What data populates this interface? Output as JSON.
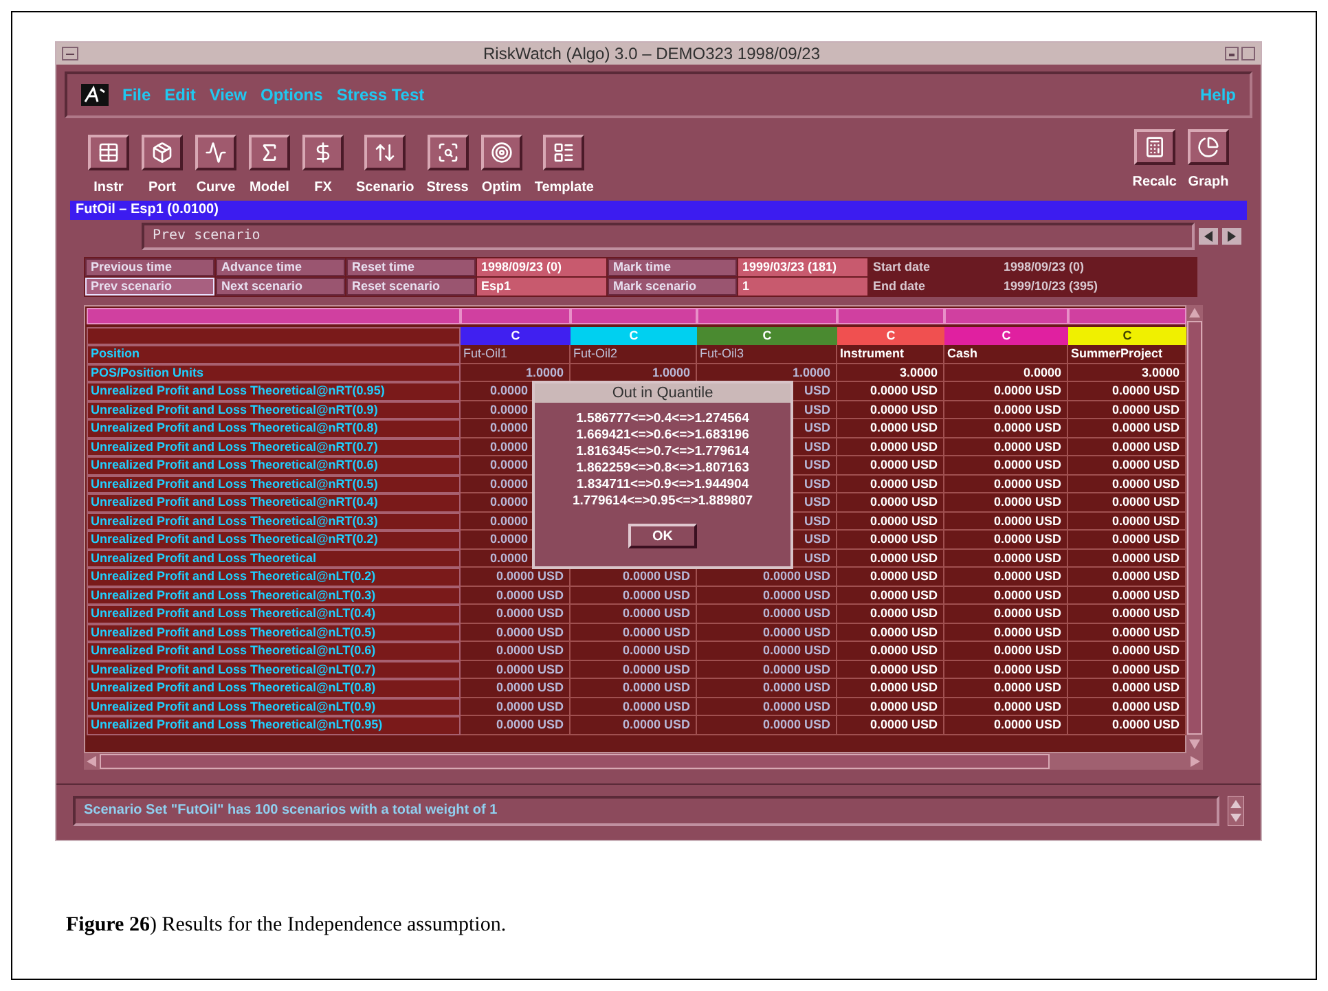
{
  "window": {
    "title": "RiskWatch (Algo) 3.0 – DEMO323 1998/09/23"
  },
  "menu": [
    "File",
    "Edit",
    "View",
    "Options",
    "Stress Test"
  ],
  "help_menu": "Help",
  "toolbar": [
    "Instr",
    "Port",
    "Curve",
    "Model",
    "FX",
    "Scenario",
    "Stress",
    "Optim",
    "Template"
  ],
  "toolbar_right": [
    "Recalc",
    "Graph"
  ],
  "panel": {
    "title": "FutOil – Esp1 (0.0100)",
    "scenario_field": "Prev scenario"
  },
  "controls": [
    [
      {
        "kind": "button",
        "text": "Previous time",
        "selected": false
      },
      {
        "kind": "button",
        "text": "Advance time",
        "selected": false
      },
      {
        "kind": "button",
        "text": "Reset time",
        "selected": false
      },
      {
        "kind": "value",
        "text": "1998/09/23 (0)"
      },
      {
        "kind": "button",
        "text": "Mark time",
        "selected": false
      },
      {
        "kind": "value",
        "text": "1999/03/23 (181)"
      },
      {
        "kind": "label",
        "text": "Start date"
      },
      {
        "kind": "label",
        "text": "1998/09/23 (0)"
      }
    ],
    [
      {
        "kind": "button",
        "text": "Prev scenario",
        "selected": true
      },
      {
        "kind": "button",
        "text": "Next scenario",
        "selected": false
      },
      {
        "kind": "button",
        "text": "Reset scenario",
        "selected": false
      },
      {
        "kind": "value",
        "text": "Esp1"
      },
      {
        "kind": "button",
        "text": "Mark scenario",
        "selected": false
      },
      {
        "kind": "value",
        "text": "1"
      },
      {
        "kind": "label",
        "text": "End date"
      },
      {
        "kind": "label",
        "text": "1999/10/23 (395)"
      }
    ]
  ],
  "table": {
    "columns": [
      {
        "code": "C",
        "color": "#4020f0",
        "name": "Fut-Oil1"
      },
      {
        "code": "C",
        "color": "#00d0f0",
        "name": "Fut-Oil2"
      },
      {
        "code": "C",
        "color": "#4a8a30",
        "name": "Fut-Oil3"
      },
      {
        "code": "C",
        "color": "#f05050",
        "name": "Instrument"
      },
      {
        "code": "C",
        "color": "#e020a0",
        "name": "Cash"
      },
      {
        "code": "C",
        "color": "#f0f000",
        "name": "SummerProject"
      }
    ],
    "position_label": "Position",
    "rows": [
      {
        "label": "POS/Position Units",
        "covered": false,
        "values": [
          "1.0000",
          "1.0000",
          "1.0000",
          "3.0000",
          "0.0000",
          "3.0000"
        ]
      },
      {
        "label": "Unrealized Profit and Loss Theoretical@nRT(0.95)",
        "covered": true,
        "values": [
          "0.0000",
          "USD",
          "0.0000 USD",
          "0.0000 USD",
          "0.0000 USD"
        ]
      },
      {
        "label": "Unrealized Profit and Loss Theoretical@nRT(0.9)",
        "covered": true,
        "values": [
          "0.0000",
          "USD",
          "0.0000 USD",
          "0.0000 USD",
          "0.0000 USD"
        ]
      },
      {
        "label": "Unrealized Profit and Loss Theoretical@nRT(0.8)",
        "covered": true,
        "values": [
          "0.0000",
          "USD",
          "0.0000 USD",
          "0.0000 USD",
          "0.0000 USD"
        ]
      },
      {
        "label": "Unrealized Profit and Loss Theoretical@nRT(0.7)",
        "covered": true,
        "values": [
          "0.0000",
          "USD",
          "0.0000 USD",
          "0.0000 USD",
          "0.0000 USD"
        ]
      },
      {
        "label": "Unrealized Profit and Loss Theoretical@nRT(0.6)",
        "covered": true,
        "values": [
          "0.0000",
          "USD",
          "0.0000 USD",
          "0.0000 USD",
          "0.0000 USD"
        ]
      },
      {
        "label": "Unrealized Profit and Loss Theoretical@nRT(0.5)",
        "covered": true,
        "values": [
          "0.0000",
          "USD",
          "0.0000 USD",
          "0.0000 USD",
          "0.0000 USD"
        ]
      },
      {
        "label": "Unrealized Profit and Loss Theoretical@nRT(0.4)",
        "covered": true,
        "values": [
          "0.0000",
          "USD",
          "0.0000 USD",
          "0.0000 USD",
          "0.0000 USD"
        ]
      },
      {
        "label": "Unrealized Profit and Loss Theoretical@nRT(0.3)",
        "covered": true,
        "values": [
          "0.0000",
          "USD",
          "0.0000 USD",
          "0.0000 USD",
          "0.0000 USD"
        ]
      },
      {
        "label": "Unrealized Profit and Loss Theoretical@nRT(0.2)",
        "covered": true,
        "values": [
          "0.0000",
          "USD",
          "0.0000 USD",
          "0.0000 USD",
          "0.0000 USD"
        ]
      },
      {
        "label": "Unrealized Profit and Loss Theoretical",
        "covered": true,
        "values": [
          "0.0000",
          "USD",
          "0.0000 USD",
          "0.0000 USD",
          "0.0000 USD"
        ]
      },
      {
        "label": "Unrealized Profit and Loss Theoretical@nLT(0.2)",
        "covered": false,
        "values": [
          "0.0000 USD",
          "0.0000 USD",
          "0.0000 USD",
          "0.0000 USD",
          "0.0000 USD",
          "0.0000 USD"
        ]
      },
      {
        "label": "Unrealized Profit and Loss Theoretical@nLT(0.3)",
        "covered": false,
        "values": [
          "0.0000 USD",
          "0.0000 USD",
          "0.0000 USD",
          "0.0000 USD",
          "0.0000 USD",
          "0.0000 USD"
        ]
      },
      {
        "label": "Unrealized Profit and Loss Theoretical@nLT(0.4)",
        "covered": false,
        "values": [
          "0.0000 USD",
          "0.0000 USD",
          "0.0000 USD",
          "0.0000 USD",
          "0.0000 USD",
          "0.0000 USD"
        ]
      },
      {
        "label": "Unrealized Profit and Loss Theoretical@nLT(0.5)",
        "covered": false,
        "values": [
          "0.0000 USD",
          "0.0000 USD",
          "0.0000 USD",
          "0.0000 USD",
          "0.0000 USD",
          "0.0000 USD"
        ]
      },
      {
        "label": "Unrealized Profit and Loss Theoretical@nLT(0.6)",
        "covered": false,
        "values": [
          "0.0000 USD",
          "0.0000 USD",
          "0.0000 USD",
          "0.0000 USD",
          "0.0000 USD",
          "0.0000 USD"
        ]
      },
      {
        "label": "Unrealized Profit and Loss Theoretical@nLT(0.7)",
        "covered": false,
        "values": [
          "0.0000 USD",
          "0.0000 USD",
          "0.0000 USD",
          "0.0000 USD",
          "0.0000 USD",
          "0.0000 USD"
        ]
      },
      {
        "label": "Unrealized Profit and Loss Theoretical@nLT(0.8)",
        "covered": false,
        "values": [
          "0.0000 USD",
          "0.0000 USD",
          "0.0000 USD",
          "0.0000 USD",
          "0.0000 USD",
          "0.0000 USD"
        ]
      },
      {
        "label": "Unrealized Profit and Loss Theoretical@nLT(0.9)",
        "covered": false,
        "values": [
          "0.0000 USD",
          "0.0000 USD",
          "0.0000 USD",
          "0.0000 USD",
          "0.0000 USD",
          "0.0000 USD"
        ]
      },
      {
        "label": "Unrealized Profit and Loss Theoretical@nLT(0.95)",
        "covered": false,
        "values": [
          "0.0000 USD",
          "0.0000 USD",
          "0.0000 USD",
          "0.0000 USD",
          "0.0000 USD",
          "0.0000 USD"
        ]
      }
    ]
  },
  "dialog": {
    "title": "Out in Quantile",
    "lines": [
      "1.586777<=>0.4<=>1.274564",
      "1.669421<=>0.6<=>1.683196",
      "1.816345<=>0.7<=>1.779614",
      "1.862259<=>0.8<=>1.807163",
      "1.834711<=>0.9<=>1.944904",
      "1.779614<=>0.95<=>1.889807"
    ],
    "button": "OK"
  },
  "status": "Scenario Set \"FutOil\" has 100 scenarios with a total weight of 1",
  "caption": "**Figure 26**) Results for the Independence assumption."
}
